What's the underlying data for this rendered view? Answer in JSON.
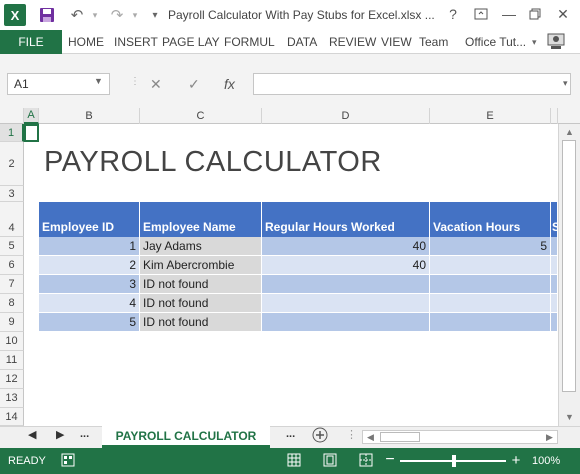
{
  "window": {
    "title": "Payroll Calculator With Pay Stubs for Excel.xlsx ...",
    "help": "?"
  },
  "ribbon": {
    "file": "FILE",
    "tabs": [
      "HOME",
      "INSERT",
      "PAGE LAY",
      "FORMUL",
      "DATA",
      "REVIEW",
      "VIEW",
      "Team"
    ],
    "account": "Office Tut..."
  },
  "formula_bar": {
    "name_box": "A1",
    "fx": "fx",
    "formula": ""
  },
  "columns": [
    "A",
    "B",
    "C",
    "D",
    "E"
  ],
  "rows": [
    "1",
    "2",
    "3",
    "4",
    "5",
    "6",
    "7",
    "8",
    "9",
    "10",
    "11",
    "12",
    "13",
    "14"
  ],
  "sheet": {
    "title": "PAYROLL CALCULATOR",
    "headers": [
      "Employee ID",
      "Employee Name",
      "Regular Hours Worked",
      "Vacation Hours",
      "S"
    ],
    "data_rows": [
      {
        "id": "1",
        "name": "Jay Adams",
        "regular": "40",
        "vacation": "5"
      },
      {
        "id": "2",
        "name": "Kim Abercrombie",
        "regular": "40",
        "vacation": ""
      },
      {
        "id": "3",
        "name": "ID not found",
        "regular": "",
        "vacation": ""
      },
      {
        "id": "4",
        "name": "ID not found",
        "regular": "",
        "vacation": ""
      },
      {
        "id": "5",
        "name": "ID not found",
        "regular": "",
        "vacation": ""
      }
    ]
  },
  "sheet_tabs": {
    "active": "PAYROLL CALCULATOR",
    "ellipsis": "..."
  },
  "status": {
    "text": "READY",
    "zoom": "100%"
  },
  "colors": {
    "excel_green": "#217346",
    "header_blue": "#4472c4",
    "row_light": "#dae3f3",
    "row_mid": "#b4c7e7",
    "row_gray": "#d9d9d9"
  }
}
